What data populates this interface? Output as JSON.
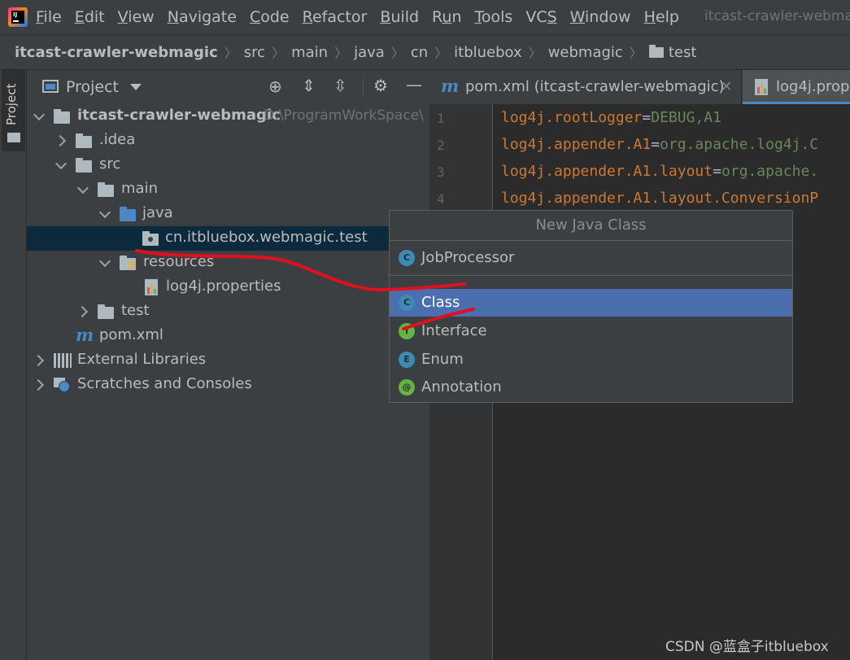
{
  "menubar": {
    "items": [
      {
        "label": "File",
        "mnemonic": "F",
        "rest": "ile"
      },
      {
        "label": "Edit",
        "mnemonic": "E",
        "rest": "dit"
      },
      {
        "label": "View",
        "mnemonic": "V",
        "rest": "iew"
      },
      {
        "label": "Navigate",
        "mnemonic": "N",
        "rest": "avigate"
      },
      {
        "label": "Code",
        "mnemonic": "C",
        "rest": "ode"
      },
      {
        "label": "Refactor",
        "mnemonic": "R",
        "rest": "efactor"
      },
      {
        "label": "Build",
        "mnemonic": "B",
        "rest": "uild"
      },
      {
        "label": "Run",
        "mnemonic": "u",
        "pre": "R",
        "rest": "n"
      },
      {
        "label": "Tools",
        "mnemonic": "T",
        "rest": "ools"
      },
      {
        "label": "VCS",
        "mnemonic": "S",
        "pre": "VC",
        "rest": ""
      },
      {
        "label": "Window",
        "mnemonic": "W",
        "rest": "indow"
      },
      {
        "label": "Help",
        "mnemonic": "H",
        "rest": "elp"
      }
    ],
    "window_title": "itcast-crawler-webmagic"
  },
  "breadcrumb": [
    "itcast-crawler-webmagic",
    "src",
    "main",
    "java",
    "cn",
    "itbluebox",
    "webmagic",
    "test"
  ],
  "project_panel": {
    "title": "Project",
    "tree": {
      "root": {
        "label": "itcast-crawler-webmagic",
        "path": "D:\\ProgramWorkSpace\\"
      },
      "idea": ".idea",
      "src": "src",
      "main": "main",
      "java": "java",
      "package": "cn.itbluebox.webmagic.test",
      "resources": "resources",
      "log4j": "log4j.properties",
      "test": "test",
      "pom": "pom.xml",
      "external_libraries": "External Libraries",
      "scratches": "Scratches and Consoles"
    }
  },
  "stripe": {
    "project_label": "Project"
  },
  "editor": {
    "tabs": [
      {
        "label": "pom.xml (itcast-crawler-webmagic)",
        "close": "×"
      },
      {
        "label": "log4j.prope"
      }
    ],
    "lines": [
      {
        "no": "1",
        "key": "log4j.rootLogger",
        "eq": "=",
        "val": "DEBUG,A1"
      },
      {
        "no": "2",
        "key": "log4j.appender.A1",
        "eq": "=",
        "val": "org.apache.log4j.C"
      },
      {
        "no": "3",
        "key": "log4j.appender.A1.layout",
        "eq": "=",
        "val": "org.apache."
      },
      {
        "no": "4",
        "key": "log4j.appender.A1.layout.ConversionP",
        "eq": "",
        "val": ""
      }
    ]
  },
  "popup": {
    "title": "New Java Class",
    "name_value": "JobProcessor",
    "items": [
      {
        "label": "Class",
        "icon": "C"
      },
      {
        "label": "Interface",
        "icon": "I"
      },
      {
        "label": "Enum",
        "icon": "E"
      },
      {
        "label": "Annotation",
        "icon": "@"
      }
    ]
  },
  "colors": {
    "accent": "#4b6eaf",
    "annotation": "#e0101e",
    "selection": "#0d293e"
  },
  "watermark": "CSDN @蓝盒子itbluebox"
}
